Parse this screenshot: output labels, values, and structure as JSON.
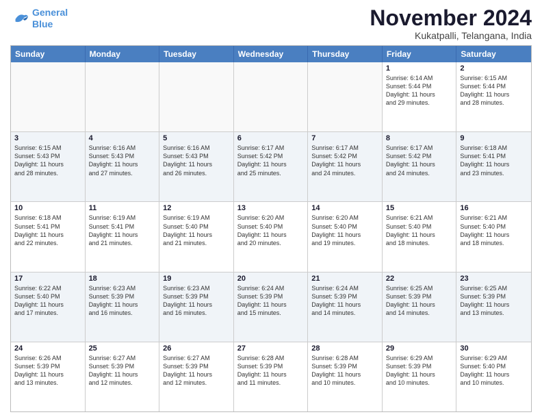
{
  "logo": {
    "line1": "General",
    "line2": "Blue"
  },
  "title": "November 2024",
  "location": "Kukatpalli, Telangana, India",
  "days_header": [
    "Sunday",
    "Monday",
    "Tuesday",
    "Wednesday",
    "Thursday",
    "Friday",
    "Saturday"
  ],
  "rows": [
    {
      "alt": false,
      "cells": [
        {
          "empty": true
        },
        {
          "empty": true
        },
        {
          "empty": true
        },
        {
          "empty": true
        },
        {
          "empty": true
        },
        {
          "day": "1",
          "lines": [
            "Sunrise: 6:14 AM",
            "Sunset: 5:44 PM",
            "Daylight: 11 hours",
            "and 29 minutes."
          ]
        },
        {
          "day": "2",
          "lines": [
            "Sunrise: 6:15 AM",
            "Sunset: 5:44 PM",
            "Daylight: 11 hours",
            "and 28 minutes."
          ]
        }
      ]
    },
    {
      "alt": true,
      "cells": [
        {
          "day": "3",
          "lines": [
            "Sunrise: 6:15 AM",
            "Sunset: 5:43 PM",
            "Daylight: 11 hours",
            "and 28 minutes."
          ]
        },
        {
          "day": "4",
          "lines": [
            "Sunrise: 6:16 AM",
            "Sunset: 5:43 PM",
            "Daylight: 11 hours",
            "and 27 minutes."
          ]
        },
        {
          "day": "5",
          "lines": [
            "Sunrise: 6:16 AM",
            "Sunset: 5:43 PM",
            "Daylight: 11 hours",
            "and 26 minutes."
          ]
        },
        {
          "day": "6",
          "lines": [
            "Sunrise: 6:17 AM",
            "Sunset: 5:42 PM",
            "Daylight: 11 hours",
            "and 25 minutes."
          ]
        },
        {
          "day": "7",
          "lines": [
            "Sunrise: 6:17 AM",
            "Sunset: 5:42 PM",
            "Daylight: 11 hours",
            "and 24 minutes."
          ]
        },
        {
          "day": "8",
          "lines": [
            "Sunrise: 6:17 AM",
            "Sunset: 5:42 PM",
            "Daylight: 11 hours",
            "and 24 minutes."
          ]
        },
        {
          "day": "9",
          "lines": [
            "Sunrise: 6:18 AM",
            "Sunset: 5:41 PM",
            "Daylight: 11 hours",
            "and 23 minutes."
          ]
        }
      ]
    },
    {
      "alt": false,
      "cells": [
        {
          "day": "10",
          "lines": [
            "Sunrise: 6:18 AM",
            "Sunset: 5:41 PM",
            "Daylight: 11 hours",
            "and 22 minutes."
          ]
        },
        {
          "day": "11",
          "lines": [
            "Sunrise: 6:19 AM",
            "Sunset: 5:41 PM",
            "Daylight: 11 hours",
            "and 21 minutes."
          ]
        },
        {
          "day": "12",
          "lines": [
            "Sunrise: 6:19 AM",
            "Sunset: 5:40 PM",
            "Daylight: 11 hours",
            "and 21 minutes."
          ]
        },
        {
          "day": "13",
          "lines": [
            "Sunrise: 6:20 AM",
            "Sunset: 5:40 PM",
            "Daylight: 11 hours",
            "and 20 minutes."
          ]
        },
        {
          "day": "14",
          "lines": [
            "Sunrise: 6:20 AM",
            "Sunset: 5:40 PM",
            "Daylight: 11 hours",
            "and 19 minutes."
          ]
        },
        {
          "day": "15",
          "lines": [
            "Sunrise: 6:21 AM",
            "Sunset: 5:40 PM",
            "Daylight: 11 hours",
            "and 18 minutes."
          ]
        },
        {
          "day": "16",
          "lines": [
            "Sunrise: 6:21 AM",
            "Sunset: 5:40 PM",
            "Daylight: 11 hours",
            "and 18 minutes."
          ]
        }
      ]
    },
    {
      "alt": true,
      "cells": [
        {
          "day": "17",
          "lines": [
            "Sunrise: 6:22 AM",
            "Sunset: 5:40 PM",
            "Daylight: 11 hours",
            "and 17 minutes."
          ]
        },
        {
          "day": "18",
          "lines": [
            "Sunrise: 6:23 AM",
            "Sunset: 5:39 PM",
            "Daylight: 11 hours",
            "and 16 minutes."
          ]
        },
        {
          "day": "19",
          "lines": [
            "Sunrise: 6:23 AM",
            "Sunset: 5:39 PM",
            "Daylight: 11 hours",
            "and 16 minutes."
          ]
        },
        {
          "day": "20",
          "lines": [
            "Sunrise: 6:24 AM",
            "Sunset: 5:39 PM",
            "Daylight: 11 hours",
            "and 15 minutes."
          ]
        },
        {
          "day": "21",
          "lines": [
            "Sunrise: 6:24 AM",
            "Sunset: 5:39 PM",
            "Daylight: 11 hours",
            "and 14 minutes."
          ]
        },
        {
          "day": "22",
          "lines": [
            "Sunrise: 6:25 AM",
            "Sunset: 5:39 PM",
            "Daylight: 11 hours",
            "and 14 minutes."
          ]
        },
        {
          "day": "23",
          "lines": [
            "Sunrise: 6:25 AM",
            "Sunset: 5:39 PM",
            "Daylight: 11 hours",
            "and 13 minutes."
          ]
        }
      ]
    },
    {
      "alt": false,
      "cells": [
        {
          "day": "24",
          "lines": [
            "Sunrise: 6:26 AM",
            "Sunset: 5:39 PM",
            "Daylight: 11 hours",
            "and 13 minutes."
          ]
        },
        {
          "day": "25",
          "lines": [
            "Sunrise: 6:27 AM",
            "Sunset: 5:39 PM",
            "Daylight: 11 hours",
            "and 12 minutes."
          ]
        },
        {
          "day": "26",
          "lines": [
            "Sunrise: 6:27 AM",
            "Sunset: 5:39 PM",
            "Daylight: 11 hours",
            "and 12 minutes."
          ]
        },
        {
          "day": "27",
          "lines": [
            "Sunrise: 6:28 AM",
            "Sunset: 5:39 PM",
            "Daylight: 11 hours",
            "and 11 minutes."
          ]
        },
        {
          "day": "28",
          "lines": [
            "Sunrise: 6:28 AM",
            "Sunset: 5:39 PM",
            "Daylight: 11 hours",
            "and 10 minutes."
          ]
        },
        {
          "day": "29",
          "lines": [
            "Sunrise: 6:29 AM",
            "Sunset: 5:39 PM",
            "Daylight: 11 hours",
            "and 10 minutes."
          ]
        },
        {
          "day": "30",
          "lines": [
            "Sunrise: 6:29 AM",
            "Sunset: 5:40 PM",
            "Daylight: 11 hours",
            "and 10 minutes."
          ]
        }
      ]
    }
  ]
}
